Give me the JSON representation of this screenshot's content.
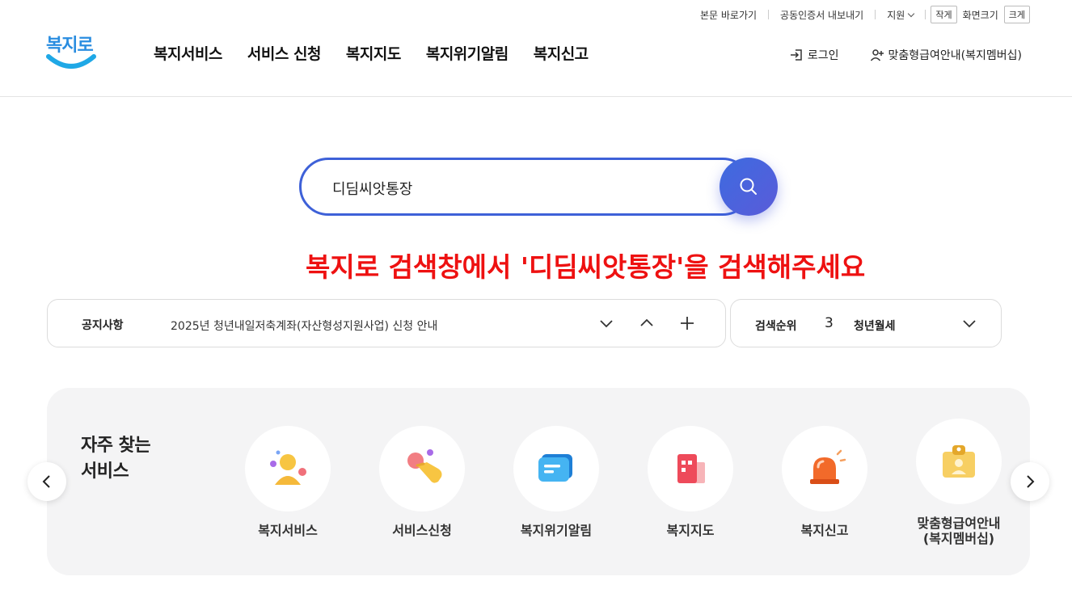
{
  "util": {
    "skip": "본문 바로가기",
    "cert": "공동인증서 내보내기",
    "support": "지원",
    "small": "작게",
    "zoom_label": "화면크기",
    "large": "크게"
  },
  "logo": {
    "text": "복지로"
  },
  "gnb": [
    {
      "label": "복지서비스"
    },
    {
      "label": "서비스 신청"
    },
    {
      "label": "복지지도"
    },
    {
      "label": "복지위기알림"
    },
    {
      "label": "복지신고"
    }
  ],
  "header": {
    "login": "로그인",
    "membership": "맞춤형급여안내(복지멤버십)"
  },
  "search": {
    "value": "디딤씨앗통장"
  },
  "instruction": "복지로 검색창에서 '디딤씨앗통장'을 검색해주세요",
  "notice": {
    "label": "공지사항",
    "text": "2025년 청년내일저축계좌(자산형성지원사업) 신청 안내"
  },
  "rank": {
    "label": "검색순위",
    "number": "3",
    "keyword": "청년월세"
  },
  "freq": {
    "title_line1": "자주 찾는",
    "title_line2": "서비스",
    "services": [
      {
        "label": "복지서비스",
        "icon": "person-icon"
      },
      {
        "label": "서비스신청",
        "icon": "hand-tap-icon"
      },
      {
        "label": "복지위기알림",
        "icon": "message-icon"
      },
      {
        "label": "복지지도",
        "icon": "building-icon"
      },
      {
        "label": "복지신고",
        "icon": "siren-icon"
      },
      {
        "label_line1": "맞춤형급여안내",
        "label_line2": "(복지멤버십)",
        "icon": "id-card-icon"
      }
    ]
  },
  "colors": {
    "accent": "#3e61d8",
    "instruction": "#ee1111",
    "logo": "#2a8de0"
  }
}
